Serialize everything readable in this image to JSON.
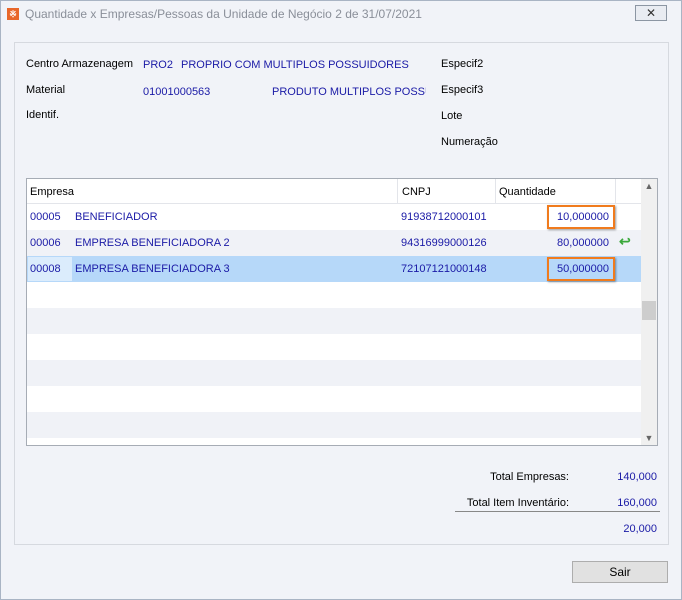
{
  "window": {
    "title": "Quantidade x Empresas/Pessoas da Unidade de Negócio 2 de 31/07/2021",
    "close_label": "✕"
  },
  "header": {
    "centro_label": "Centro Armazenagem",
    "centro_code": "PRO2",
    "centro_name": "PROPRIO COM MULTIPLOS POSSUIDORES",
    "material_label": "Material",
    "material_code": "01001000563",
    "material_name": "PRODUTO MULTIPLOS POSSUID",
    "identif_label": "Identif.",
    "especif2_label": "Especif2",
    "especif3_label": "Especif3",
    "lote_label": "Lote",
    "numeracao_label": "Numeração"
  },
  "grid": {
    "columns": [
      "Empresa",
      "CNPJ",
      "Quantidade"
    ],
    "rows": [
      {
        "code": "00005",
        "name": "BENEFICIADOR",
        "cnpj": "91938712000101",
        "qty": "10,000000"
      },
      {
        "code": "00006",
        "name": "EMPRESA BENEFICIADORA 2",
        "cnpj": "94316999000126",
        "qty": "80,000000"
      },
      {
        "code": "00008",
        "name": "EMPRESA BENEFICIADORA 3",
        "cnpj": "72107121000148",
        "qty": "50,000000"
      }
    ]
  },
  "totals": {
    "empresas_label": "Total Empresas:",
    "empresas_value": "140,000",
    "inventario_label": "Total Item Inventário:",
    "inventario_value": "160,000",
    "diff_value": "20,000"
  },
  "footer": {
    "sair_label": "Sair"
  },
  "colors": {
    "highlight": "#f07b1d",
    "selected": "#b6d8f9",
    "value_text": "#1a1aa6"
  }
}
